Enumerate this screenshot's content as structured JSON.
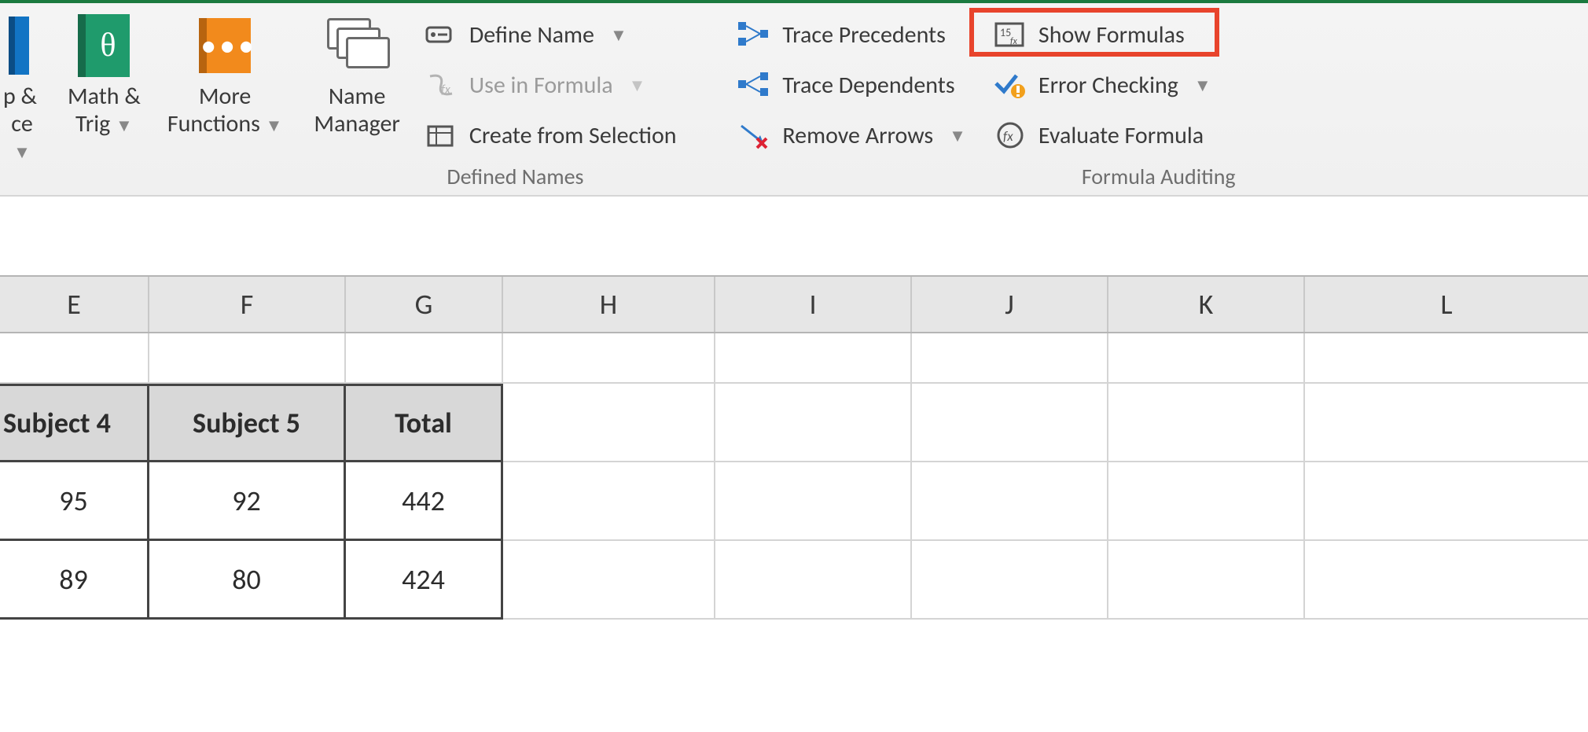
{
  "ribbon": {
    "library": {
      "lookup": {
        "line1": "p &",
        "line2": "ce",
        "caret": "▼"
      },
      "math": {
        "line1": "Math &",
        "line2": "Trig",
        "caret": "▼"
      },
      "more": {
        "line1": "More",
        "line2": "Functions",
        "caret": "▼"
      }
    },
    "defined_names": {
      "manager": {
        "line1": "Name",
        "line2": "Manager"
      },
      "define_name": "Define Name",
      "use_in_formula": "Use in Formula",
      "create_selection": "Create from Selection",
      "label": "Defined Names"
    },
    "auditing": {
      "trace_precedents": "Trace Precedents",
      "trace_dependents": "Trace Dependents",
      "remove_arrows": "Remove Arrows",
      "show_formulas": "Show Formulas",
      "error_checking": "Error Checking",
      "evaluate_formula": "Evaluate Formula",
      "label": "Formula Auditing"
    }
  },
  "columns": [
    "E",
    "F",
    "G",
    "H",
    "I",
    "J",
    "K",
    "L"
  ],
  "table": {
    "headers": [
      "Subject 4",
      "Subject 5",
      "Total"
    ],
    "rows": [
      {
        "e": "95",
        "f": "92",
        "g": "442"
      },
      {
        "e": "89",
        "f": "80",
        "g": "424"
      }
    ]
  }
}
